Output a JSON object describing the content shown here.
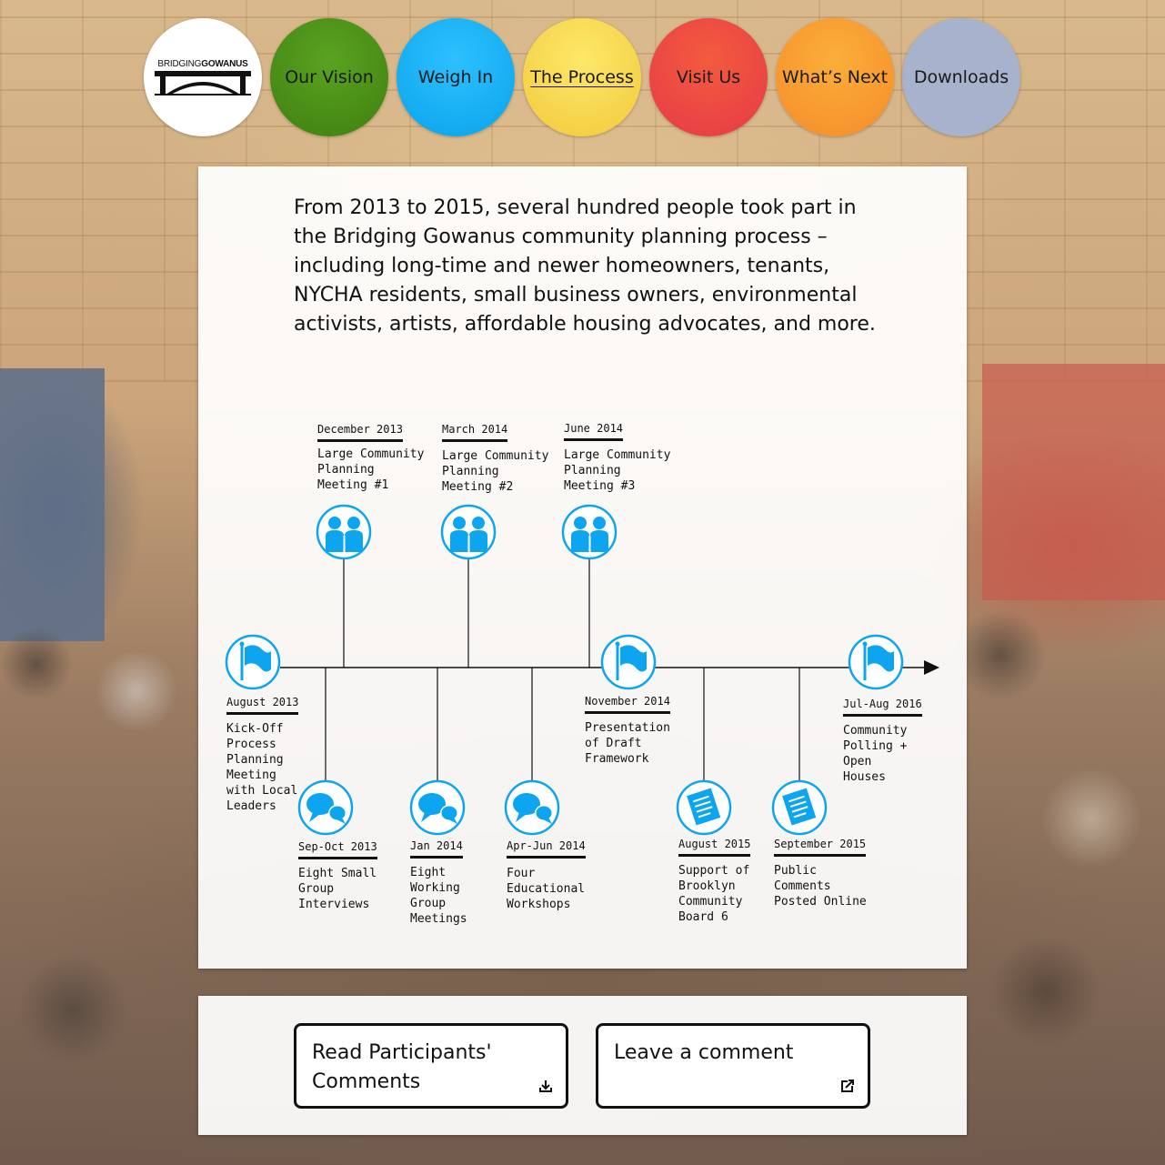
{
  "nav": {
    "logo": {
      "text_light": "BRIDGING",
      "text_bold": "GOWANUS"
    },
    "items": [
      {
        "label": "Our Vision"
      },
      {
        "label": "Weigh In"
      },
      {
        "label": "The Process",
        "active": true
      },
      {
        "label": "Visit Us"
      },
      {
        "label": "What’s Next"
      },
      {
        "label": "Downloads"
      }
    ]
  },
  "intro": "From 2013 to 2015, several hundred people took part in the Bridging Gowanus community planning process – including long-time and newer homeowners, tenants, NYCHA residents, small business owners, environmental activists, artists, affordable housing advocates, and more.",
  "colors": {
    "accent": "#0ea5f0",
    "line": "#111111"
  },
  "timeline": {
    "events": [
      {
        "date": "August 2013",
        "desc": "Kick-Off\nProcess\nPlanning\nMeeting\nwith Local\nLeaders",
        "icon": "flag-icon"
      },
      {
        "date": "Sep-Oct 2013",
        "desc": "Eight Small\nGroup\nInterviews",
        "icon": "chat-bubbles-icon"
      },
      {
        "date": "December 2013",
        "desc": "Large Community\nPlanning\nMeeting #1",
        "icon": "people-icon"
      },
      {
        "date": "Jan 2014",
        "desc": "Eight\nWorking\nGroup\nMeetings",
        "icon": "chat-bubbles-icon"
      },
      {
        "date": "March 2014",
        "desc": "Large Community\nPlanning\nMeeting #2",
        "icon": "people-icon"
      },
      {
        "date": "Apr-Jun 2014",
        "desc": "Four\nEducational\nWorkshops",
        "icon": "chat-bubbles-icon"
      },
      {
        "date": "June 2014",
        "desc": "Large Community\nPlanning\nMeeting #3",
        "icon": "people-icon"
      },
      {
        "date": "November 2014",
        "desc": "Presentation\nof Draft\nFramework",
        "icon": "flag-icon"
      },
      {
        "date": "August 2015",
        "desc": "Support of\nBrooklyn\nCommunity\nBoard 6",
        "icon": "document-icon"
      },
      {
        "date": "September 2015",
        "desc": "Public\nComments\nPosted Online",
        "icon": "document-icon"
      },
      {
        "date": "Jul-Aug 2016",
        "desc": "Community\nPolling +\nOpen\nHouses",
        "icon": "flag-icon"
      }
    ]
  },
  "actions": {
    "read_comments": {
      "label": "Read Participants' Comments",
      "icon": "download-icon"
    },
    "leave_comment": {
      "label": "Leave a comment",
      "icon": "external-link-icon"
    }
  }
}
